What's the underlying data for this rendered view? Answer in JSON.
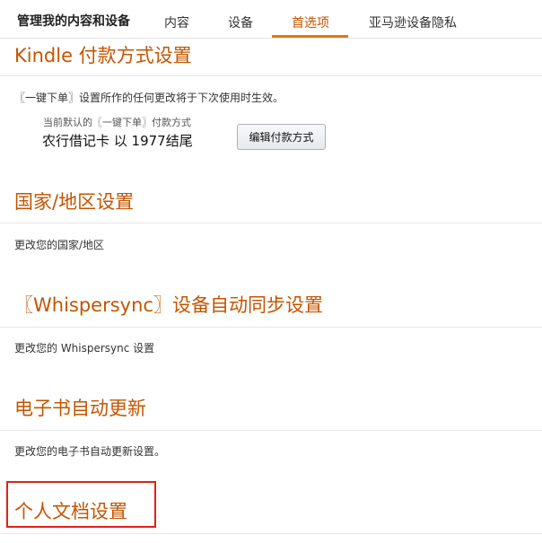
{
  "nav": {
    "title": "管理我的内容和设备",
    "tabs": [
      {
        "label": "内容"
      },
      {
        "label": "设备"
      },
      {
        "label": "首选项"
      },
      {
        "label": "亚马逊设备隐私"
      }
    ],
    "active_tab": "首选项"
  },
  "kindle_payment": {
    "title": "Kindle 付款方式设置",
    "description": "〖一键下单〗设置所作的任何更改将于下次使用时生效。",
    "current_label": "当前默认的〖一键下单〗付款方式",
    "current_value": "农行借记卡 以 1977结尾",
    "edit_button": "编辑付款方式"
  },
  "country": {
    "title": "国家/地区设置",
    "description": "更改您的国家/地区"
  },
  "whispersync": {
    "title": "〖Whispersync〗设备自动同步设置",
    "description": "更改您的 Whispersync 设置"
  },
  "ebook_update": {
    "title": "电子书自动更新",
    "description": "更改您的电子书自动更新设置。"
  },
  "personal_docs": {
    "title": "个人文档设置"
  },
  "colors": {
    "accent": "#c45500",
    "tab_underline": "#e47911",
    "highlight": "#e0201a"
  }
}
